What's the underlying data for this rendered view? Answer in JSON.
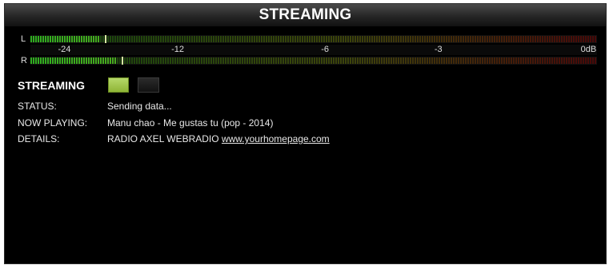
{
  "title": "STREAMING",
  "meter": {
    "left_label": "L",
    "right_label": "R",
    "left_level": 0.12,
    "right_level": 0.15,
    "ticks": [
      {
        "label": "-24",
        "db": -24
      },
      {
        "label": "-12",
        "db": -12
      },
      {
        "label": "-6",
        "db": -6
      },
      {
        "label": "-3",
        "db": -3
      },
      {
        "label": "0dB",
        "db": 0
      }
    ],
    "colors": {
      "low": "#2fae1f",
      "mid": "#8fa31a",
      "high": "#b01414"
    }
  },
  "streaming": {
    "label": "STREAMING",
    "on": true,
    "on_color": "#9fc84a"
  },
  "info": {
    "status_label": "STATUS:",
    "status_value": "Sending data...",
    "now_playing_label": "NOW PLAYING:",
    "now_playing_value": "Manu chao - Me gustas tu (pop - 2014)",
    "details_label": "DETAILS:",
    "details_value": "RADIO AXEL  WEBRADIO",
    "details_link": "www.yourhomepage.com"
  }
}
